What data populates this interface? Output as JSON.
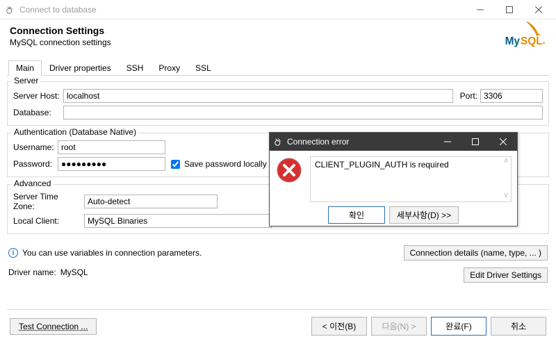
{
  "window": {
    "title": "Connect to database"
  },
  "header": {
    "title": "Connection Settings",
    "subtitle": "MySQL connection settings"
  },
  "tabs": [
    {
      "label": "Main"
    },
    {
      "label": "Driver properties"
    },
    {
      "label": "SSH"
    },
    {
      "label": "Proxy"
    },
    {
      "label": "SSL"
    }
  ],
  "server": {
    "legend": "Server",
    "host_label": "Server Host:",
    "host_value": "localhost",
    "port_label": "Port:",
    "port_value": "3306",
    "db_label": "Database:",
    "db_value": ""
  },
  "auth": {
    "legend": "Authentication (Database Native)",
    "user_label": "Username:",
    "user_value": "root",
    "pw_label": "Password:",
    "pw_value": "●●●●●●●●●",
    "save_pw": "Save password locally",
    "save_pw_checked": true
  },
  "adv": {
    "legend": "Advanced",
    "tz_label": "Server Time Zone:",
    "tz_value": "Auto-detect",
    "lc_label": "Local Client:",
    "lc_value": "MySQL Binaries"
  },
  "info": {
    "text": "You can use variables in connection parameters."
  },
  "buttons": {
    "conn_details": "Connection details (name, type, ... )",
    "edit_driver": "Edit Driver Settings"
  },
  "driver": {
    "label": "Driver name:",
    "value": "MySQL"
  },
  "footer": {
    "test": "Test Connection ...",
    "prev": "< 이전(B)",
    "next": "다음(N) >",
    "finish": "완료(F)",
    "cancel": "취소"
  },
  "dialog": {
    "title": "Connection error",
    "message": "CLIENT_PLUGIN_AUTH is required",
    "ok": "확인",
    "details": "세부사항(D) >>"
  },
  "icons": {
    "app": "db-icon",
    "logo": "mysql-logo",
    "info": "info-icon",
    "error": "error-icon"
  }
}
